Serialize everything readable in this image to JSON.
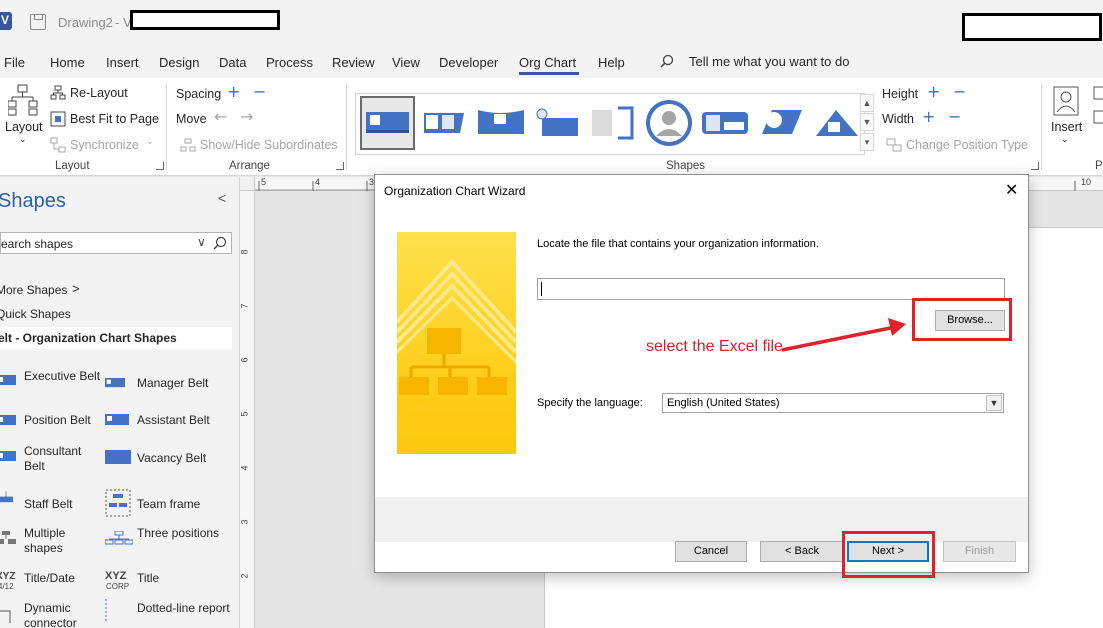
{
  "titlebar": {
    "doc_title": "Drawing2",
    "separator": "-  V"
  },
  "menu": {
    "items": [
      "File",
      "Home",
      "Insert",
      "Design",
      "Data",
      "Process",
      "Review",
      "View",
      "Developer",
      "Org Chart",
      "Help"
    ],
    "active": "Org Chart",
    "tell_me": "Tell me what you want to do"
  },
  "ribbon": {
    "layout_group": {
      "layout_label": "Layout",
      "relayout": "Re-Layout",
      "best_fit": "Best Fit to Page",
      "synchronize": "Synchronize",
      "group_label": "Layout"
    },
    "arrange_group": {
      "spacing": "Spacing",
      "move": "Move",
      "show_hide": "Show/Hide Subordinates",
      "group_label": "Arrange"
    },
    "shapes_group": {
      "group_label": "Shapes",
      "height": "Height",
      "width": "Width",
      "change_position_type": "Change Position Type"
    },
    "insert_group": {
      "insert_label": "Insert"
    }
  },
  "shapes_pane": {
    "title": "Shapes",
    "search_placeholder": "earch shapes",
    "more_shapes": "More Shapes",
    "quick_shapes": "Quick Shapes",
    "active_stencil": "elt - Organization Chart Shapes",
    "items": [
      {
        "label": "Executive Belt"
      },
      {
        "label": "Manager Belt"
      },
      {
        "label": "Position Belt"
      },
      {
        "label": "Assistant Belt"
      },
      {
        "label": "Consultant Belt"
      },
      {
        "label": "Vacancy Belt"
      },
      {
        "label": "Staff Belt"
      },
      {
        "label": "Team frame"
      },
      {
        "label": "Multiple shapes"
      },
      {
        "label": "Three positions"
      },
      {
        "label": "Title/Date"
      },
      {
        "label": "Title"
      },
      {
        "label": "Dynamic connector"
      },
      {
        "label": "Dotted-line report"
      }
    ]
  },
  "rulers": {
    "top": [
      "5",
      "4",
      "3",
      "10"
    ],
    "left": [
      "8",
      "7",
      "6",
      "5",
      "4",
      "3",
      "2"
    ]
  },
  "dialog": {
    "title": "Organization Chart Wizard",
    "instruction": "Locate the file that contains your organization information.",
    "file_path_value": "",
    "browse_button": "Browse...",
    "language_label": "Specify the language:",
    "language_value": "English (United States)",
    "buttons": {
      "cancel": "Cancel",
      "back": "< Back",
      "next": "Next >",
      "finish": "Finish"
    }
  },
  "annotation": {
    "text": "select the Excel file",
    "color": "#e0202a"
  },
  "colors": {
    "accent": "#3955a3",
    "shape_blue": "#4472c4",
    "wizard_yellow": "#ffd400"
  }
}
